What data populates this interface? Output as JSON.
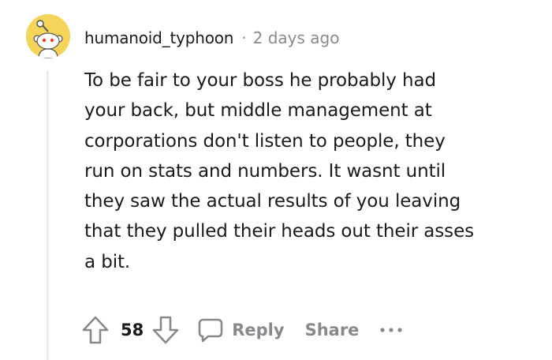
{
  "comment": {
    "author": "humanoid_typhoon",
    "separator": "·",
    "timestamp": "2 days ago",
    "body_lines": [
      "To be fair to your boss he probably had",
      "your back, but middle management at",
      "corporations don't listen to people, they",
      "run on stats and numbers. It wasnt until",
      "they saw the actual results of you leaving",
      "that they pulled their heads out their asses",
      "a bit."
    ],
    "avatar_color": "#f5d45a"
  },
  "actions": {
    "vote_count": "58",
    "reply_label": "Reply",
    "share_label": "Share",
    "icons": {
      "upvote": "upvote-arrow-icon",
      "downvote": "downvote-arrow-icon",
      "reply": "speech-bubble-icon",
      "more": "more-dots-icon"
    },
    "muted_color": "#878a8c"
  }
}
